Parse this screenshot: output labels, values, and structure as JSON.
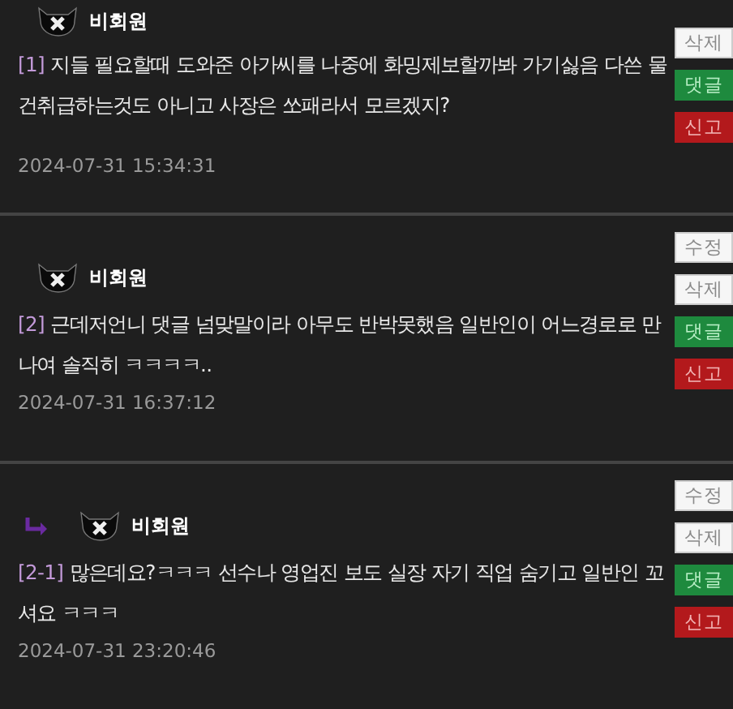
{
  "comments": [
    {
      "reply": false,
      "author": "비회원",
      "number": "[1]",
      "text": "지들 필요할때 도와준 아가씨를 나중에 화밍제보할까봐 가기싫음 다쓴 물건취급하는것도 아니고 사장은 쏘패라서 모르겠지?",
      "date": "2024-07-31 15:34:31",
      "buttons": [
        {
          "kind": "plain",
          "label": "삭제"
        },
        {
          "kind": "reply",
          "label": "댓글"
        },
        {
          "kind": "report",
          "label": "신고"
        }
      ]
    },
    {
      "reply": false,
      "author": "비회원",
      "number": "[2]",
      "text": "근데저언니 댓글 넘맞말이라 아무도 반박못했음 일반인이 어느경로로 만나여 솔직히 ㅋㅋㅋㅋ..",
      "date": "2024-07-31 16:37:12",
      "buttons": [
        {
          "kind": "plain",
          "label": "수정"
        },
        {
          "kind": "plain",
          "label": "삭제"
        },
        {
          "kind": "reply",
          "label": "댓글"
        },
        {
          "kind": "report",
          "label": "신고"
        }
      ]
    },
    {
      "reply": true,
      "author": "비회원",
      "number": "[2-1]",
      "text": "많은데요?ㅋㅋㅋ 선수나 영업진 보도 실장 자기 직업 숨기고 일반인 꼬셔요 ㅋㅋㅋ",
      "date": "2024-07-31 23:20:46",
      "buttons": [
        {
          "kind": "plain",
          "label": "수정"
        },
        {
          "kind": "plain",
          "label": "삭제"
        },
        {
          "kind": "reply",
          "label": "댓글"
        },
        {
          "kind": "report",
          "label": "신고"
        }
      ]
    }
  ]
}
